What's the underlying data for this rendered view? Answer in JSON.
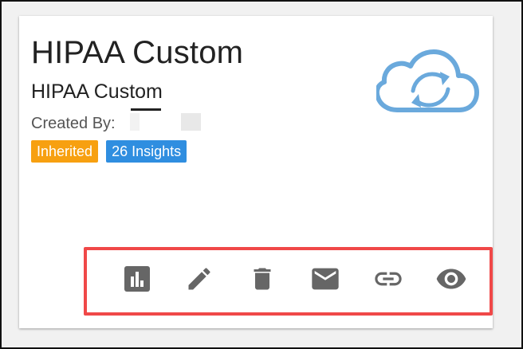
{
  "card": {
    "title": "HIPAA Custom",
    "subtitle": "HIPAA Custom",
    "created_by_label": "Created By:",
    "badges": [
      {
        "label": "Inherited",
        "color": "#f7a010"
      },
      {
        "label": "26 Insights",
        "color": "#2f8ee0"
      }
    ],
    "logo_icon": "cloud-sync-icon",
    "logo_color": "#6aa9dc"
  },
  "actions": [
    {
      "icon": "bar-chart-icon"
    },
    {
      "icon": "pencil-icon"
    },
    {
      "icon": "trash-icon"
    },
    {
      "icon": "envelope-icon"
    },
    {
      "icon": "link-icon"
    },
    {
      "icon": "eye-icon"
    }
  ],
  "colors": {
    "icon_gray": "#666666",
    "highlight_border": "#f04848"
  }
}
